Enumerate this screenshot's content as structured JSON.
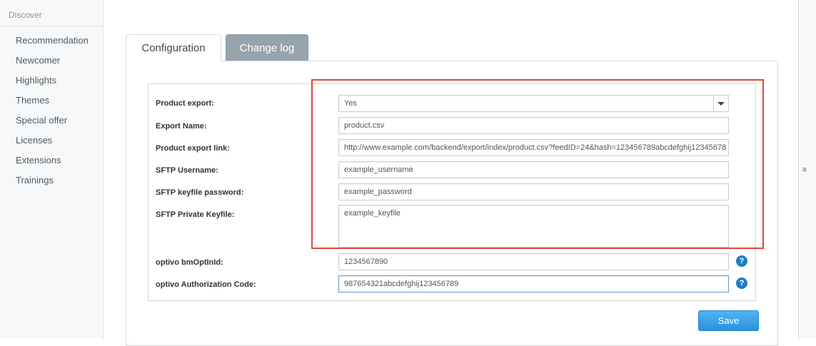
{
  "sidebar": {
    "title": "Discover",
    "items": [
      {
        "label": "Recommendation"
      },
      {
        "label": "Newcomer"
      },
      {
        "label": "Highlights"
      },
      {
        "label": "Themes"
      },
      {
        "label": "Special offer"
      },
      {
        "label": "Licenses"
      },
      {
        "label": "Extensions"
      },
      {
        "label": "Trainings"
      }
    ]
  },
  "tabs": [
    {
      "label": "Configuration",
      "active": true
    },
    {
      "label": "Change log",
      "active": false
    }
  ],
  "form": {
    "product_export": {
      "label": "Product export:",
      "value": "Yes"
    },
    "export_name": {
      "label": "Export Name:",
      "value": "product.csv"
    },
    "product_export_link": {
      "label": "Product export link:",
      "value": "http://www.example.com/backend/export/index/product.csv?feedID=24&hash=123456789abcdefghij12345678"
    },
    "sftp_username": {
      "label": "SFTP Username:",
      "value": "example_username"
    },
    "sftp_keyfile_password": {
      "label": "SFTP keyfile password:",
      "value": "example_password"
    },
    "sftp_private_keyfile": {
      "label": "SFTP Private Keyfile:",
      "value": "example_keyfile"
    },
    "optivo_bmoptinid": {
      "label": "optivo bmOptInId:",
      "value": "1234567890"
    },
    "optivo_auth_code": {
      "label": "optivo Authorization Code:",
      "value": "987654321abcdefghij123456789"
    }
  },
  "help_icon": "?",
  "save_label": "Save",
  "colors": {
    "highlight": "#e0493b",
    "accent": "#2a92de",
    "tab_inactive": "#96a4ad"
  }
}
